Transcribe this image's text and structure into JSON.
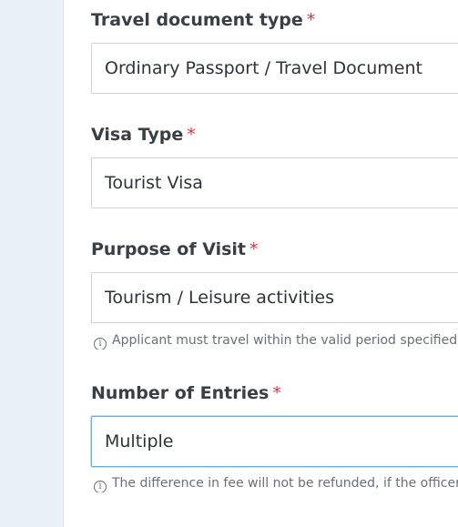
{
  "form": {
    "travel_document": {
      "label": "Travel document type",
      "required_mark": "*",
      "value": "Ordinary Passport / Travel Document"
    },
    "visa_type": {
      "label": "Visa Type",
      "required_mark": "*",
      "value": "Tourist Visa"
    },
    "purpose": {
      "label": "Purpose of Visit",
      "required_mark": "*",
      "value": "Tourism / Leisure activities",
      "hint": "Applicant must travel within the valid period specified in the"
    },
    "entries": {
      "label": "Number of Entries",
      "required_mark": "*",
      "value": "Multiple",
      "hint": "The difference in fee will not be refunded, if the officer grants"
    }
  },
  "icons": {
    "info": "info-icon"
  },
  "colors": {
    "sidebar_bg": "#e8f0f8",
    "required": "#d9363e",
    "focus_border": "#5ab1e6"
  }
}
